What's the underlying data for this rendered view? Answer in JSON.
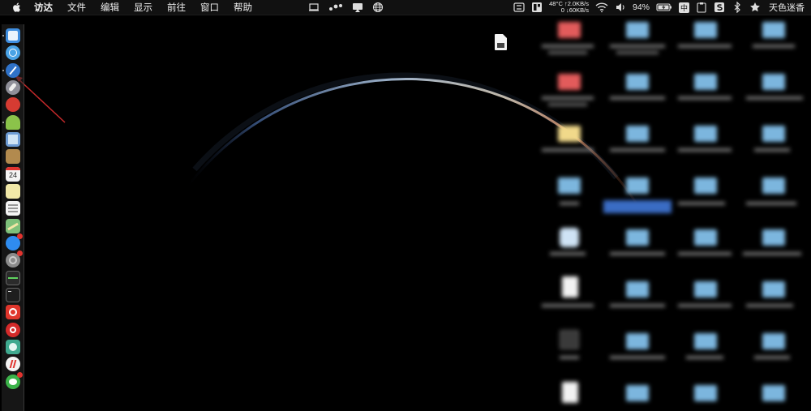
{
  "menubar": {
    "app_name": "访达",
    "items": [
      "文件",
      "编辑",
      "显示",
      "前往",
      "窗口",
      "帮助"
    ],
    "temperature": "48°C",
    "upload_speed": "↑2.0KB/s",
    "download_speed_count": "0",
    "download_speed": "↓60KB/s",
    "battery_percent": "94%",
    "input_method": "中",
    "user_name": "天色迷香"
  },
  "dock": {
    "items": [
      {
        "icon": "finder-icon",
        "color": "#3f8ee0"
      },
      {
        "icon": "safari-icon",
        "color": "#4aa3e6"
      },
      {
        "icon": "compass-icon",
        "color": "#2f72c8"
      },
      {
        "icon": "launchpad-icon",
        "color": "#8f8f99"
      },
      {
        "icon": "app-red-icon",
        "color": "#d63b32"
      },
      {
        "icon": "android-icon",
        "color": "#8bc34a"
      },
      {
        "icon": "preview-icon",
        "color": "#6d9bd4"
      },
      {
        "icon": "notes-brown-icon",
        "color": "#b28a4e"
      },
      {
        "icon": "calendar-icon",
        "color": "#f4f4f4"
      },
      {
        "icon": "notes-icon",
        "color": "#f2e9a8"
      },
      {
        "icon": "reminders-icon",
        "color": "#f4f4f4"
      },
      {
        "icon": "maps-icon",
        "color": "#7ec07a"
      },
      {
        "icon": "app-store-icon",
        "color": "#2f8cf0"
      },
      {
        "icon": "system-preferences-icon",
        "color": "#8b8b8b"
      },
      {
        "icon": "activity-monitor-icon",
        "color": "#2b2b2b"
      },
      {
        "icon": "terminal-icon",
        "color": "#1e1e1e"
      },
      {
        "icon": "vivaldi-icon",
        "color": "#e0362c"
      },
      {
        "icon": "netease-music-icon",
        "color": "#d42a2a"
      },
      {
        "icon": "app-teal-icon",
        "color": "#3fa98f"
      },
      {
        "icon": "yandex-icon",
        "color": "#f3f3f3"
      },
      {
        "icon": "wechat-icon",
        "color": "#3cb34a"
      }
    ],
    "calendar_day": "24"
  }
}
